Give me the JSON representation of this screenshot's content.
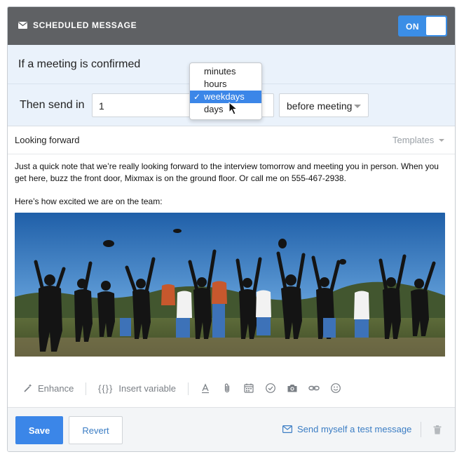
{
  "header": {
    "title": "SCHEDULED MESSAGE",
    "toggle_label": "ON"
  },
  "condition": {
    "text": "If a meeting is confirmed"
  },
  "send": {
    "label": "Then send in",
    "amount_value": "1",
    "unit_options": [
      "minutes",
      "hours",
      "weekdays",
      "days"
    ],
    "unit_selected": "weekdays",
    "timing_value": "before meeting"
  },
  "message": {
    "subject": "Looking forward",
    "templates_label": "Templates",
    "paragraphs": [
      "Just a quick note that we’re really looking forward to the interview tomorrow and meeting you in person. When you get here, buzz the front door, Mixmax is on the ground floor. Or call me on 555-467-2938.",
      "Here’s how excited we are on the team:"
    ]
  },
  "toolbar": {
    "enhance_label": "Enhance",
    "insert_variable_icon": "{{}}",
    "insert_variable_label": "Insert variable",
    "icons": [
      "text-format-icon",
      "paperclip-icon",
      "calendar-icon",
      "check-circle-icon",
      "camera-icon",
      "link-icon",
      "smiley-icon"
    ]
  },
  "footer": {
    "save_label": "Save",
    "revert_label": "Revert",
    "test_label": "Send myself a test message"
  },
  "colors": {
    "accent": "#3b86e8",
    "header_bg": "#5f6164",
    "condition_bg": "#eaf2fb",
    "link": "#3b7dc4"
  }
}
